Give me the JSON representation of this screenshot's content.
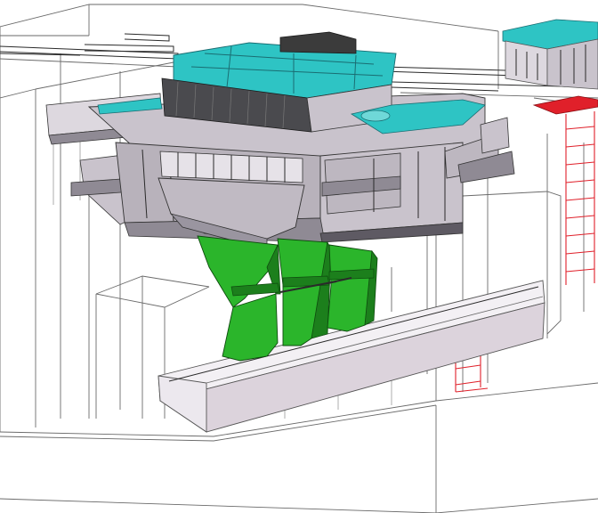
{
  "scene": {
    "kind": "3d-cad-model",
    "colors": {
      "background": "#ffffff",
      "wireframe": "#6a6a6a",
      "steel": "#c9c3cc",
      "steel_dark": "#8f8a94",
      "steel_shadow": "#5e5a63",
      "cover": "#2ec4c4",
      "cover_dark": "#1a8d92",
      "chute": "#2bb52b",
      "chute_dark": "#1c7f1c",
      "ladder": "#e0202a",
      "trough": "#dcd3dc",
      "trough_top": "#f3f0f4"
    }
  }
}
